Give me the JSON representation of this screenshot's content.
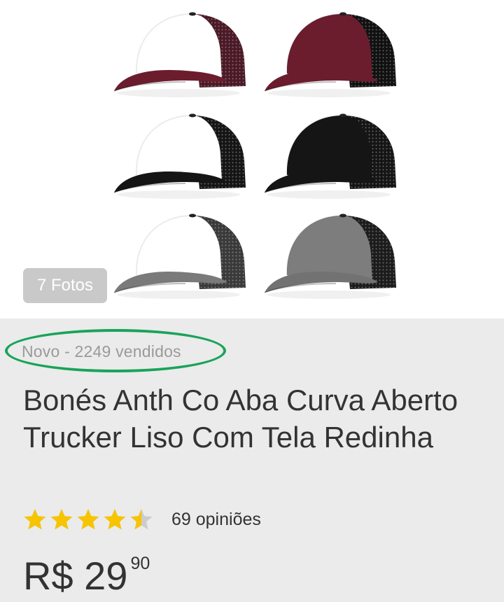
{
  "gallery": {
    "photo_count_label": "7 Fotos",
    "caps": [
      {
        "front": "#ffffff",
        "bill": "#6b1d2e",
        "mesh": "#4a1a26"
      },
      {
        "front": "#6b1d2e",
        "bill": "#6b1d2e",
        "mesh": "#111111"
      },
      {
        "front": "#ffffff",
        "bill": "#151515",
        "mesh": "#151515"
      },
      {
        "front": "#151515",
        "bill": "#151515",
        "mesh": "#151515"
      },
      {
        "front": "#ffffff",
        "bill": "#7a7a7a",
        "mesh": "#3a3a3a"
      },
      {
        "front": "#7d7d7d",
        "bill": "#727272",
        "mesh": "#1c1c1c"
      }
    ]
  },
  "product": {
    "condition": "Novo - 2249 vendidos",
    "title": "Bonés Anth Co Aba Curva Aberto Trucker Liso Com Tela Redinha",
    "rating": 4.5,
    "reviews_label": "69 opiniões",
    "price_main": "R$ 29",
    "price_cents": "90"
  },
  "colors": {
    "star": "#f7c400",
    "star_empty": "#cccccc",
    "highlight": "#1aa35a"
  }
}
